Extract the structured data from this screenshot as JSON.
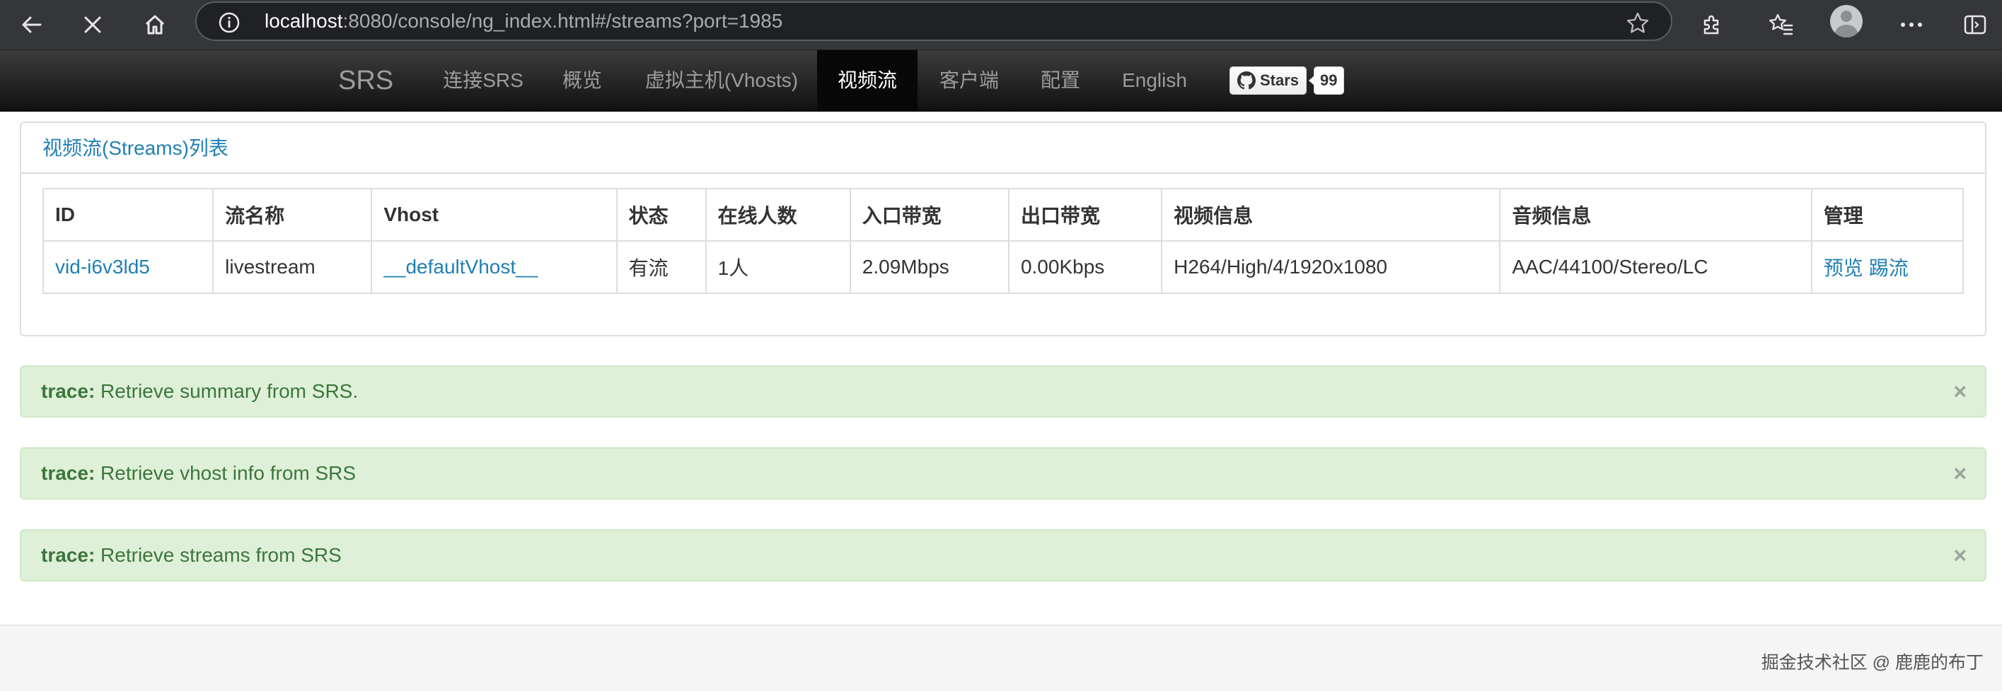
{
  "browser": {
    "url_host": "localhost",
    "url_rest": ":8080/console/ng_index.html#/streams?port=1985",
    "icons": [
      "back-arrow-icon",
      "close-icon",
      "home-icon",
      "info-icon",
      "star-icon",
      "extensions-icon",
      "favorites-icon",
      "profile-avatar",
      "more-icon",
      "sidebar-icon"
    ]
  },
  "navbar": {
    "brand": "SRS",
    "items": [
      {
        "label": "连接SRS"
      },
      {
        "label": "概览"
      },
      {
        "label": "虚拟主机(Vhosts)"
      },
      {
        "label": "视频流",
        "active": true
      },
      {
        "label": "客户端"
      },
      {
        "label": "配置"
      },
      {
        "label": "English"
      }
    ],
    "github": {
      "label": "Stars",
      "count": "99"
    }
  },
  "panel": {
    "title": "视频流(Streams)列表",
    "columns": [
      "ID",
      "流名称",
      "Vhost",
      "状态",
      "在线人数",
      "入口带宽",
      "出口带宽",
      "视频信息",
      "音频信息",
      "管理"
    ],
    "rows": [
      {
        "id": "vid-i6v3ld5",
        "name": "livestream",
        "vhost": "__defaultVhost__",
        "status": "有流",
        "clients": "1人",
        "recv": "2.09Mbps",
        "send": "0.00Kbps",
        "video": "H264/High/4/1920x1080",
        "audio": "AAC/44100/Stereo/LC",
        "action_preview": "预览",
        "action_kick": "踢流"
      }
    ]
  },
  "alerts": [
    {
      "level": "trace:",
      "message": " Retrieve summary from SRS.",
      "close": "×"
    },
    {
      "level": "trace:",
      "message": " Retrieve vhost info from SRS",
      "close": "×"
    },
    {
      "level": "trace:",
      "message": " Retrieve streams from SRS",
      "close": "×"
    }
  ],
  "watermark": "掘金技术社区 @ 鹿鹿的布丁",
  "colors": {
    "chrome_bg": "#35363a",
    "navbar_bg": "#222222",
    "link": "#1f7fb5",
    "alert_bg": "#dff0d8",
    "alert_text": "#3c763d"
  }
}
